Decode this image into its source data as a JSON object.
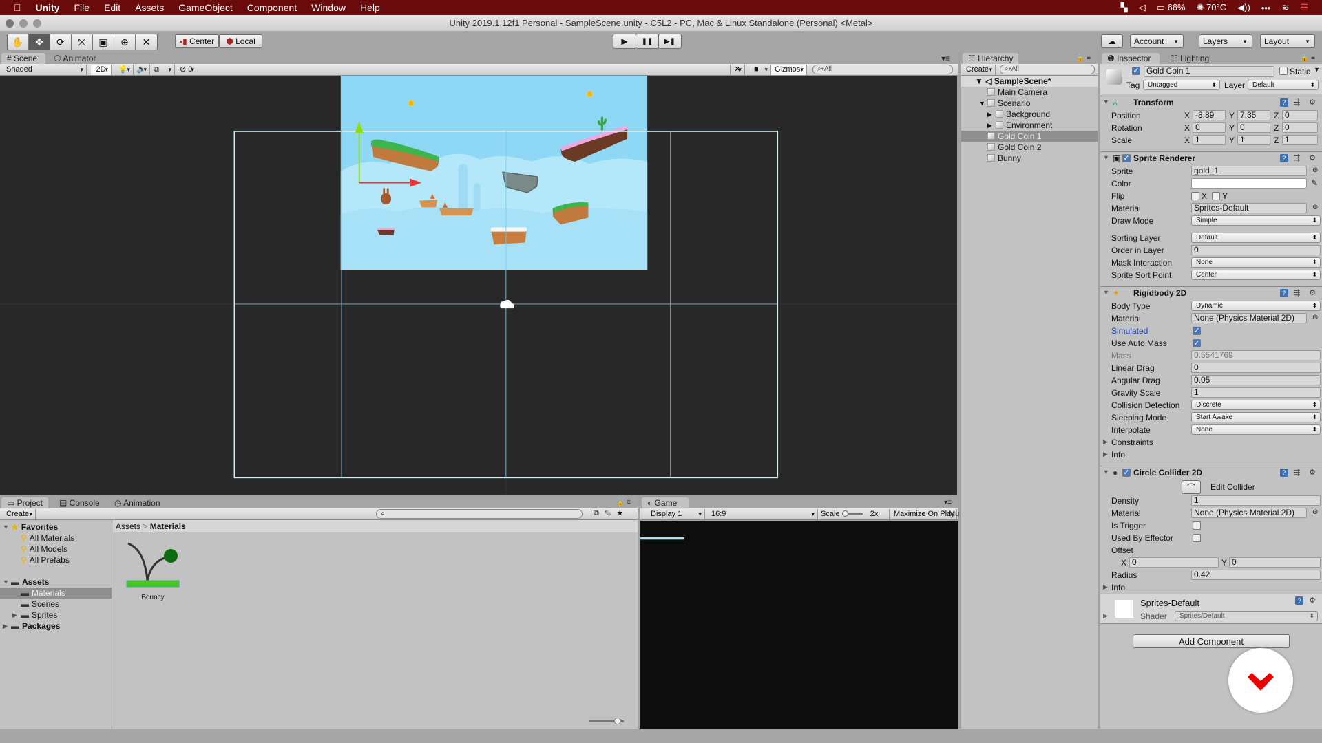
{
  "menubar": {
    "app": "Unity",
    "items": [
      "File",
      "Edit",
      "Assets",
      "GameObject",
      "Component",
      "Window",
      "Help"
    ],
    "status": {
      "battery": "66%",
      "temperature": "70°C"
    }
  },
  "window": {
    "title": "Unity 2019.1.12f1 Personal - SampleScene.unity - C5L2 - PC, Mac & Linux Standalone (Personal) <Metal>"
  },
  "toolbar": {
    "tools": [
      "hand",
      "move",
      "rotate",
      "scale",
      "rect",
      "transform",
      "custom"
    ],
    "active_tool": "move",
    "pivot": "Center",
    "space": "Local",
    "play": "▶",
    "pause": "❚❚",
    "step": "▶❚",
    "account": "Account",
    "layers": "Layers",
    "layout": "Layout"
  },
  "scene": {
    "tabs": [
      "Scene",
      "Animator"
    ],
    "shading": "Shaded",
    "mode_2d": "2D",
    "hidden_count": "0",
    "gizmos": "Gizmos",
    "search_placeholder": "All"
  },
  "hierarchy": {
    "tab": "Hierarchy",
    "create": "Create",
    "search_placeholder": "All",
    "scene": "SampleScene*",
    "items": [
      {
        "name": "Main Camera",
        "depth": 1
      },
      {
        "name": "Scenario",
        "depth": 1,
        "expanded": true
      },
      {
        "name": "Background",
        "depth": 2,
        "collapsed": true
      },
      {
        "name": "Environment",
        "depth": 2,
        "collapsed": true
      },
      {
        "name": "Gold Coin 1",
        "depth": 1,
        "selected": true
      },
      {
        "name": "Gold Coin 2",
        "depth": 1
      },
      {
        "name": "Bunny",
        "depth": 1
      }
    ]
  },
  "inspector": {
    "tabs": [
      "Inspector",
      "Lighting"
    ],
    "object_name": "Gold Coin 1",
    "active": true,
    "static_label": "Static",
    "static": false,
    "tag_label": "Tag",
    "tag": "Untagged",
    "layer_label": "Layer",
    "layer": "Default",
    "rows": [
      {
        "type": "header",
        "label": "Transform",
        "icon": "transform"
      },
      {
        "type": "vec3",
        "label": "Position",
        "x": "-8.89",
        "y": "7.35",
        "z": "0"
      },
      {
        "type": "vec3",
        "label": "Rotation",
        "x": "0",
        "y": "0",
        "z": "0"
      },
      {
        "type": "vec3",
        "label": "Scale",
        "x": "1",
        "y": "1",
        "z": "1"
      },
      {
        "type": "gap"
      },
      {
        "type": "header",
        "label": "Sprite Renderer",
        "icon": "sprite",
        "check": true
      },
      {
        "type": "object",
        "label": "Sprite",
        "value": "gold_1"
      },
      {
        "type": "color",
        "label": "Color",
        "value": "#ffffff"
      },
      {
        "type": "flip",
        "label": "Flip",
        "x": "X",
        "y": "Y"
      },
      {
        "type": "object",
        "label": "Material",
        "value": "Sprites-Default"
      },
      {
        "type": "drop",
        "label": "Draw Mode",
        "value": "Simple"
      },
      {
        "type": "gap"
      },
      {
        "type": "drop",
        "label": "Sorting Layer",
        "value": "Default"
      },
      {
        "type": "field",
        "label": "Order in Layer",
        "value": "0"
      },
      {
        "type": "drop",
        "label": "Mask Interaction",
        "value": "None"
      },
      {
        "type": "drop",
        "label": "Sprite Sort Point",
        "value": "Center"
      },
      {
        "type": "gap"
      },
      {
        "type": "header",
        "label": "Rigidbody 2D",
        "icon": "rigidbody"
      },
      {
        "type": "drop",
        "label": "Body Type",
        "value": "Dynamic"
      },
      {
        "type": "object",
        "label": "Material",
        "value": "None (Physics Material 2D)"
      },
      {
        "type": "check",
        "label": "Simulated",
        "value": true,
        "highlight": true
      },
      {
        "type": "check",
        "label": "Use Auto Mass",
        "value": true
      },
      {
        "type": "field",
        "label": "Mass",
        "value": "0.5541769",
        "disabled": true
      },
      {
        "type": "field",
        "label": "Linear Drag",
        "value": "0"
      },
      {
        "type": "field",
        "label": "Angular Drag",
        "value": "0.05"
      },
      {
        "type": "field",
        "label": "Gravity Scale",
        "value": "1"
      },
      {
        "type": "drop",
        "label": "Collision Detection",
        "value": "Discrete"
      },
      {
        "type": "drop",
        "label": "Sleeping Mode",
        "value": "Start Awake"
      },
      {
        "type": "drop",
        "label": "Interpolate",
        "value": "None"
      },
      {
        "type": "fold",
        "label": "Constraints"
      },
      {
        "type": "fold",
        "label": "Info"
      },
      {
        "type": "gap"
      },
      {
        "type": "header",
        "label": "Circle Collider 2D",
        "icon": "circle-collider",
        "check": true
      },
      {
        "type": "button",
        "label": "Edit Collider"
      },
      {
        "type": "field",
        "label": "Density",
        "value": "1"
      },
      {
        "type": "object",
        "label": "Material",
        "value": "None (Physics Material 2D)"
      },
      {
        "type": "check",
        "label": "Is Trigger",
        "value": false
      },
      {
        "type": "check",
        "label": "Used By Effector",
        "value": false
      },
      {
        "type": "label",
        "label": "Offset"
      },
      {
        "type": "vec2",
        "x": "0",
        "y": "0"
      },
      {
        "type": "field",
        "label": "Radius",
        "value": "0.42"
      },
      {
        "type": "fold",
        "label": "Info"
      }
    ],
    "material": {
      "name": "Sprites-Default",
      "shader_label": "Shader",
      "shader": "Sprites/Default"
    },
    "add_component": "Add Component"
  },
  "project": {
    "tabs": [
      "Project",
      "Console",
      "Animation"
    ],
    "create": "Create",
    "tree": [
      {
        "label": "Favorites",
        "kind": "favorites"
      },
      {
        "label": "All Materials",
        "kind": "search"
      },
      {
        "label": "All Models",
        "kind": "search"
      },
      {
        "label": "All Prefabs",
        "kind": "search"
      },
      {
        "label": "",
        "kind": "gap"
      },
      {
        "label": "Assets",
        "kind": "root"
      },
      {
        "label": "Materials",
        "kind": "folder",
        "selected": true
      },
      {
        "label": "Scenes",
        "kind": "folder"
      },
      {
        "label": "Sprites",
        "kind": "folder",
        "collapsed": true
      },
      {
        "label": "Packages",
        "kind": "root",
        "collapsed": true
      }
    ],
    "breadcrumb": [
      "Assets",
      "Materials"
    ],
    "assets": [
      {
        "name": "Bouncy",
        "type": "physics-material"
      }
    ]
  },
  "game": {
    "tab": "Game",
    "display": "Display 1",
    "aspect": "16:9",
    "scale_label": "Scale",
    "scale": "2x",
    "maximize": "Maximize On Play",
    "mute": "Mu"
  },
  "colors": {
    "menubar": "#6b0a0a",
    "sky": "#8ed8f5",
    "grass": "#3cb54a",
    "dirt": "#b86b34",
    "pink": "#f2a6e0",
    "coin": "#f7b500",
    "selection": "#8f8f8f"
  }
}
